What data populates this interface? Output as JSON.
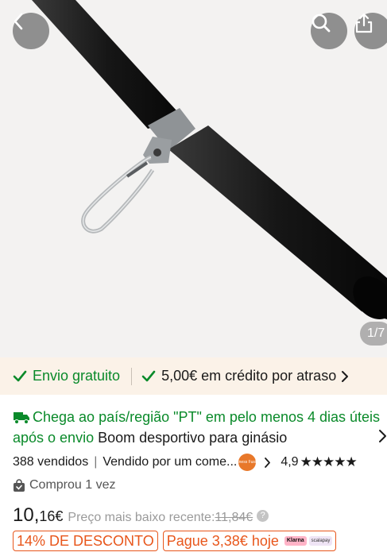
{
  "gallery": {
    "counter": "1/7"
  },
  "benefits": {
    "free_shipping": "Envio gratuito",
    "credit": "5,00€ em crédito por atraso"
  },
  "delivery": {
    "text": "Chega ao país/região \"PT\" em pelo menos  4 dias úteis após o envio",
    "product_title": "Boom desportivo para ginásio"
  },
  "stats": {
    "sold": "388 vendidos",
    "separator": "|",
    "seller": "Vendido por um come...",
    "store_logo_text": "Fitness Fusion",
    "rating": "4,9",
    "stars": "★★★★★"
  },
  "bought": {
    "text": "Comprou 1 vez"
  },
  "price": {
    "integer": "10,",
    "decimal": "16€",
    "low_label": "Preço mais baixo recente:",
    "old_price": "11,84€",
    "help": "?"
  },
  "badges": {
    "discount": "14% DE DESCONTO",
    "installment": "Pague 3,38€ hoje",
    "klarna": "Klarna",
    "scalapay": "scalapay"
  },
  "colors": {
    "green": "#0a8a2a",
    "orange": "#e8561b",
    "benefit_bg": "#fbf2e8"
  }
}
